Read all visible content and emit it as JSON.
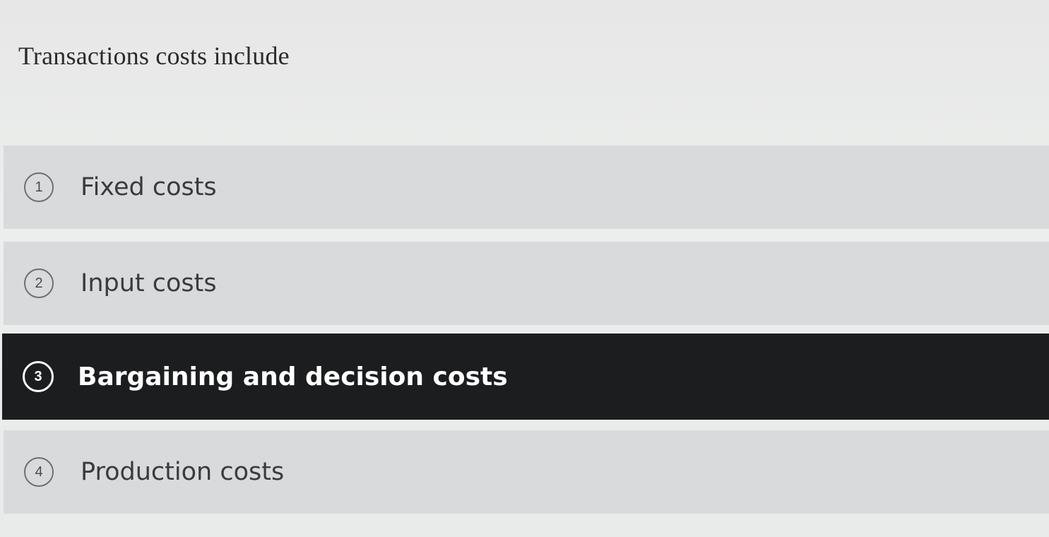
{
  "question": {
    "text": "Transactions costs include"
  },
  "options": [
    {
      "number": "1",
      "label": "Fixed costs",
      "selected": false
    },
    {
      "number": "2",
      "label": "Input costs",
      "selected": false
    },
    {
      "number": "3",
      "label": "Bargaining and decision costs",
      "selected": true
    },
    {
      "number": "4",
      "label": "Production costs",
      "selected": false
    }
  ],
  "colors": {
    "background": "#e9ebea",
    "option_background": "#d9dadb",
    "selected_background": "#1c1d1f",
    "selected_text": "#ffffff",
    "text": "#3a3b3d"
  }
}
